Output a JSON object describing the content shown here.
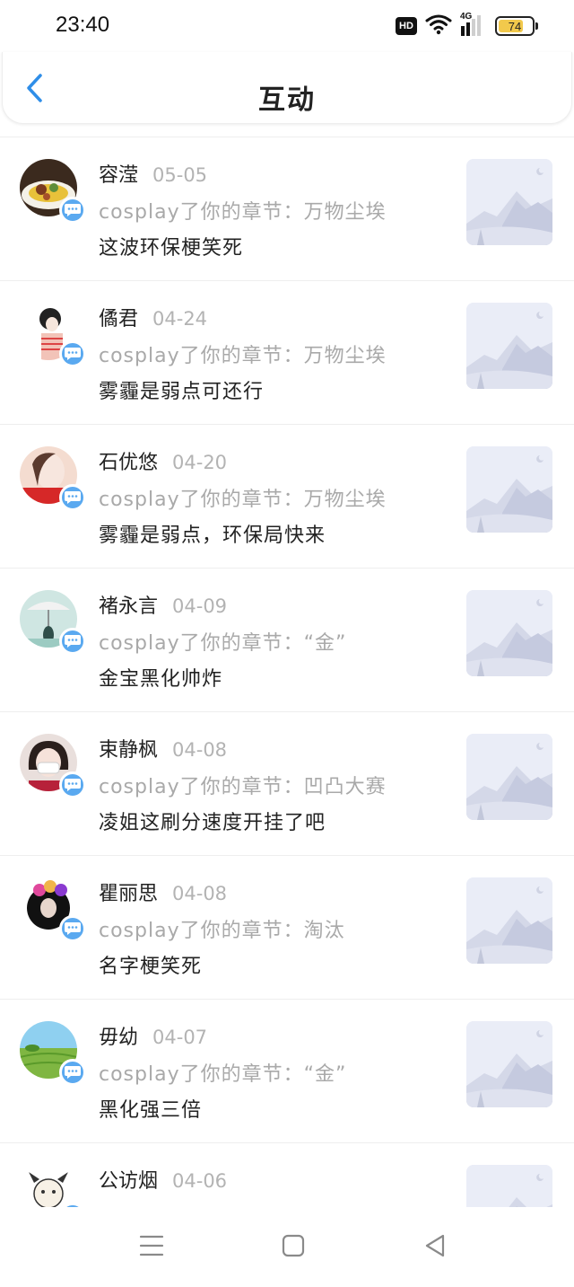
{
  "status_bar": {
    "time": "23:40",
    "hd_label": "HD",
    "network_label": "4G",
    "battery_level": "74",
    "battery_fraction": 0.74
  },
  "header": {
    "title": "互动",
    "back_icon": "chevron-left-icon",
    "accent_color": "#2f8ee8"
  },
  "items": [
    {
      "name": "容滢",
      "date": "05-05",
      "context": "cosplay了你的章节：万物尘埃",
      "comment": "这波环保梗笑死"
    },
    {
      "name": "僪君",
      "date": "04-24",
      "context": "cosplay了你的章节：万物尘埃",
      "comment": "雾霾是弱点可还行"
    },
    {
      "name": "石优悠",
      "date": "04-20",
      "context": "cosplay了你的章节：万物尘埃",
      "comment": "雾霾是弱点，环保局快来"
    },
    {
      "name": "褚永言",
      "date": "04-09",
      "context": "cosplay了你的章节：“金”",
      "comment": "金宝黑化帅炸"
    },
    {
      "name": "束静枫",
      "date": "04-08",
      "context": "cosplay了你的章节：凹凸大赛",
      "comment": "凌姐这刷分速度开挂了吧"
    },
    {
      "name": "瞿丽思",
      "date": "04-08",
      "context": "cosplay了你的章节：淘汰",
      "comment": "名字梗笑死"
    },
    {
      "name": "毋幼",
      "date": "04-07",
      "context": "cosplay了你的章节：“金”",
      "comment": "黑化强三倍"
    },
    {
      "name": "公访烟",
      "date": "04-06",
      "context": "",
      "comment": ""
    }
  ],
  "nav": {
    "menu_icon": "menu-icon",
    "home_icon": "home-square-icon",
    "back_icon": "back-triangle-icon"
  }
}
